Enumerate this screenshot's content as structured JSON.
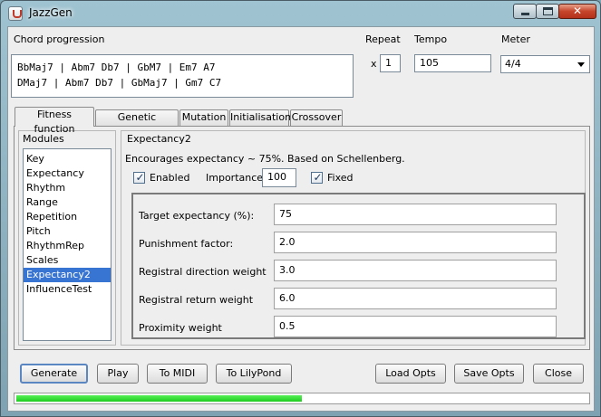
{
  "window": {
    "title": "JazzGen",
    "close_symbol": "✕"
  },
  "header": {
    "chord_label": "Chord progression",
    "chord_lines": [
      "BbMaj7 | Abm7 Db7 | GbM7 | Em7 A7",
      "DMaj7 | Abm7 Db7 | GbMaj7 | Gm7 C7"
    ],
    "repeat_label": "Repeat",
    "repeat_x": "x",
    "repeat_value": "1",
    "tempo_label": "Tempo",
    "tempo_value": "105",
    "meter_label": "Meter",
    "meter_value": "4/4"
  },
  "tabs": [
    {
      "label": "Fitness function",
      "active": true
    },
    {
      "label": "Genetic algorithm"
    },
    {
      "label": "Mutation"
    },
    {
      "label": "Initialisation"
    },
    {
      "label": "Crossover"
    }
  ],
  "modules": {
    "title": "Modules",
    "items": [
      "Key",
      "Expectancy",
      "Rhythm",
      "Range",
      "Repetition",
      "Pitch",
      "RhythmRep",
      "Scales",
      "Expectancy2",
      "InfluenceTest"
    ],
    "selected": "Expectancy2"
  },
  "module_detail": {
    "title": "Expectancy2",
    "description": "Encourages expectancy ~ 75%. Based on Schellenberg.",
    "enabled_label": "Enabled",
    "enabled_checked": true,
    "importance_label": "Importance",
    "importance_value": "100",
    "fixed_label": "Fixed",
    "fixed_checked": true,
    "params": [
      {
        "label": "Target expectancy (%):",
        "value": "75"
      },
      {
        "label": "Punishment factor:",
        "value": "2.0"
      },
      {
        "label": "Registral direction weight",
        "value": "3.0"
      },
      {
        "label": "Registral return weight",
        "value": "6.0"
      },
      {
        "label": "Proximity weight",
        "value": "0.5"
      }
    ]
  },
  "buttons": {
    "generate": "Generate",
    "play": "Play",
    "to_midi": "To MIDI",
    "to_lilypond": "To LilyPond",
    "load_opts": "Load Opts",
    "save_opts": "Save Opts",
    "close": "Close"
  },
  "progress": {
    "fraction": 0.5
  },
  "colors": {
    "selection": "#3874d1",
    "progress": "#22cc22",
    "close_button": "#c6452b"
  }
}
